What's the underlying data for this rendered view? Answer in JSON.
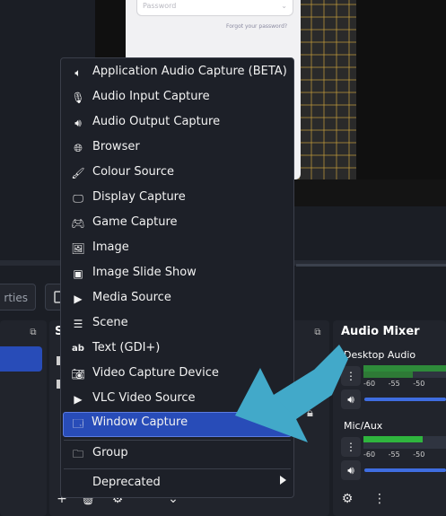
{
  "preview": {
    "password_placeholder": "Password",
    "forgot_password": "Forgot your password?"
  },
  "toolbar": {
    "properties_label": "rties"
  },
  "docks": {
    "scenes_title": "",
    "sources_title": "S",
    "mixer_title": "Audio Mixer"
  },
  "mixer": {
    "channels": [
      {
        "name": "Desktop Audio",
        "ticks": [
          "-60",
          "-55",
          "-50"
        ],
        "level": 0.6
      },
      {
        "name": "Mic/Aux",
        "ticks": [
          "-60",
          "-55",
          "-50"
        ],
        "level": 0.55
      }
    ]
  },
  "menu": {
    "items": [
      {
        "label": "Application Audio Capture (BETA)",
        "icon": "speaker-box-icon"
      },
      {
        "label": "Audio Input Capture",
        "icon": "microphone-icon"
      },
      {
        "label": "Audio Output Capture",
        "icon": "speaker-icon"
      },
      {
        "label": "Browser",
        "icon": "globe-icon"
      },
      {
        "label": "Colour Source",
        "icon": "paintbrush-icon"
      },
      {
        "label": "Display Capture",
        "icon": "monitor-icon"
      },
      {
        "label": "Game Capture",
        "icon": "gamepad-icon"
      },
      {
        "label": "Image",
        "icon": "image-icon"
      },
      {
        "label": "Image Slide Show",
        "icon": "slideshow-icon"
      },
      {
        "label": "Media Source",
        "icon": "play-icon"
      },
      {
        "label": "Scene",
        "icon": "list-icon"
      },
      {
        "label": "Text (GDI+)",
        "icon": "text-icon"
      },
      {
        "label": "Video Capture Device",
        "icon": "camera-icon"
      },
      {
        "label": "VLC Video Source",
        "icon": "play-icon"
      },
      {
        "label": "Window Capture",
        "icon": "window-icon"
      },
      {
        "label": "Group",
        "icon": "folder-icon"
      },
      {
        "label": "Deprecated",
        "icon": ""
      }
    ],
    "selected_index": 14
  },
  "colors": {
    "accent": "#284cb8",
    "arrow": "#42a9c9"
  }
}
